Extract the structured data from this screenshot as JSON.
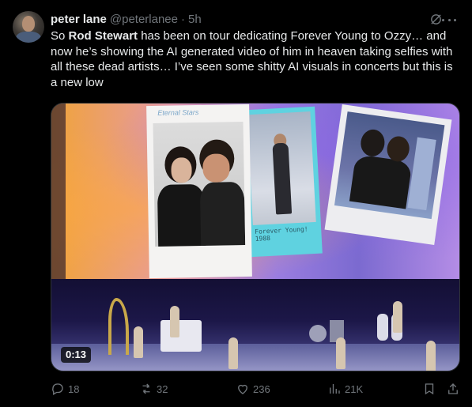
{
  "author": {
    "name": "peter lane",
    "handle": "@peterlanee",
    "separator": "·",
    "time": "5h"
  },
  "tweet": {
    "text_before": "So ",
    "text_bold": "Rod Stewart",
    "text_after": " has been on tour dedicating Forever Young to Ozzy… and now he’s showing the AI generated video of him in heaven taking selfies with all these dead artists… I’ve seen some shitty AI visuals in concerts but this is a new low"
  },
  "media": {
    "duration": "0:13",
    "photo_caption_1": "Eternal Stars",
    "photo_caption_2": "Forever Young! 1988"
  },
  "actions": {
    "replies": "18",
    "reposts": "32",
    "likes": "236",
    "views": "21K"
  },
  "icons": {
    "grok": "grok-icon",
    "more": "more-icon",
    "reply": "reply-icon",
    "repost": "repost-icon",
    "like": "like-icon",
    "views": "views-icon",
    "bookmark": "bookmark-icon",
    "share": "share-icon"
  },
  "colors": {
    "background": "#000000",
    "text": "#e7e9ea",
    "muted": "#71767b"
  }
}
